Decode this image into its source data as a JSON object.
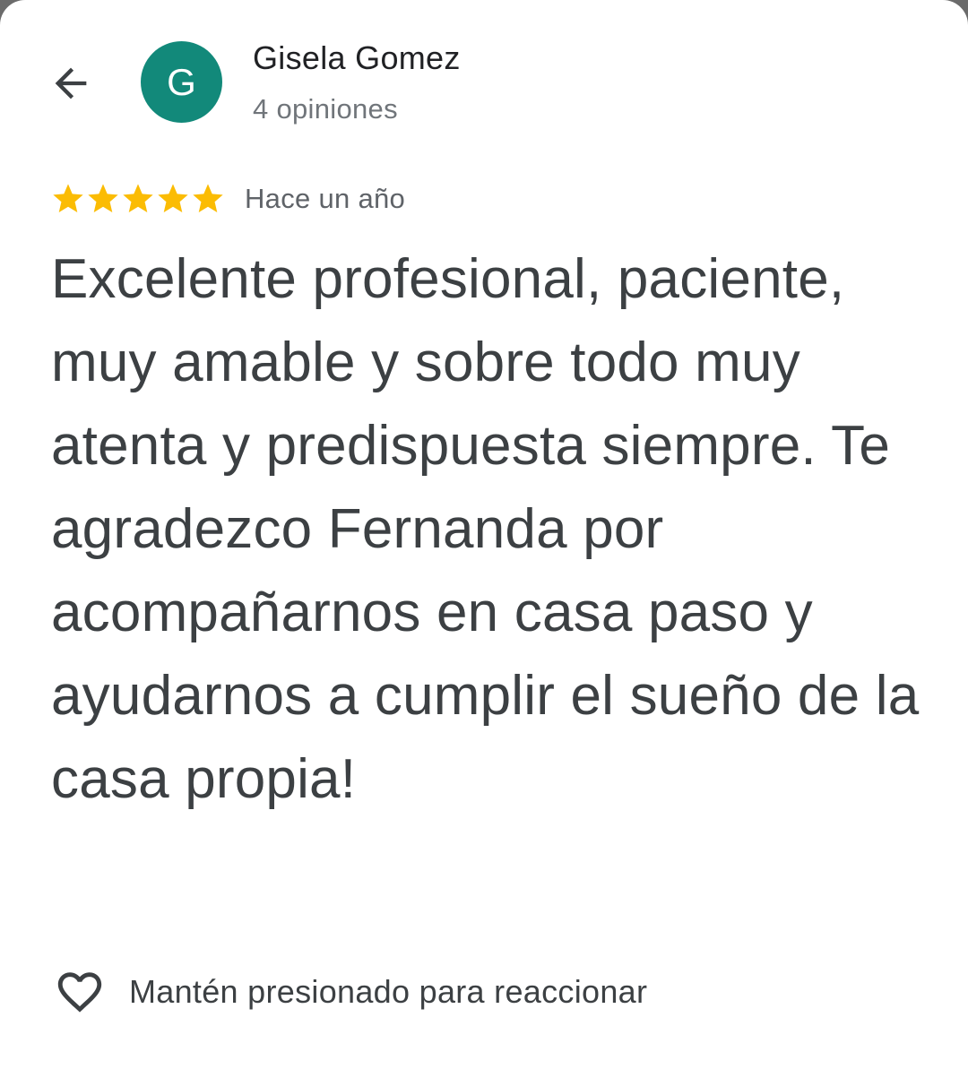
{
  "header": {
    "back_icon": "arrow-back-icon",
    "avatar_letter": "G",
    "avatar_color": "#12897a",
    "author_name": "Gisela Gomez",
    "review_count": "4 opiniones"
  },
  "review": {
    "rating": 5,
    "rating_max": 5,
    "star_color": "#fbbc04",
    "date": "Hace un año",
    "text": "Excelente profesional, paciente, muy amable y sobre todo muy atenta y predispuesta siempre. Te agradezco Fernanda por acompañarnos en casa paso y ayudarnos a cumplir el sueño de la casa propia!"
  },
  "reaction": {
    "icon": "heart-outline-icon",
    "label": "Mantén presionado para reaccionar"
  }
}
